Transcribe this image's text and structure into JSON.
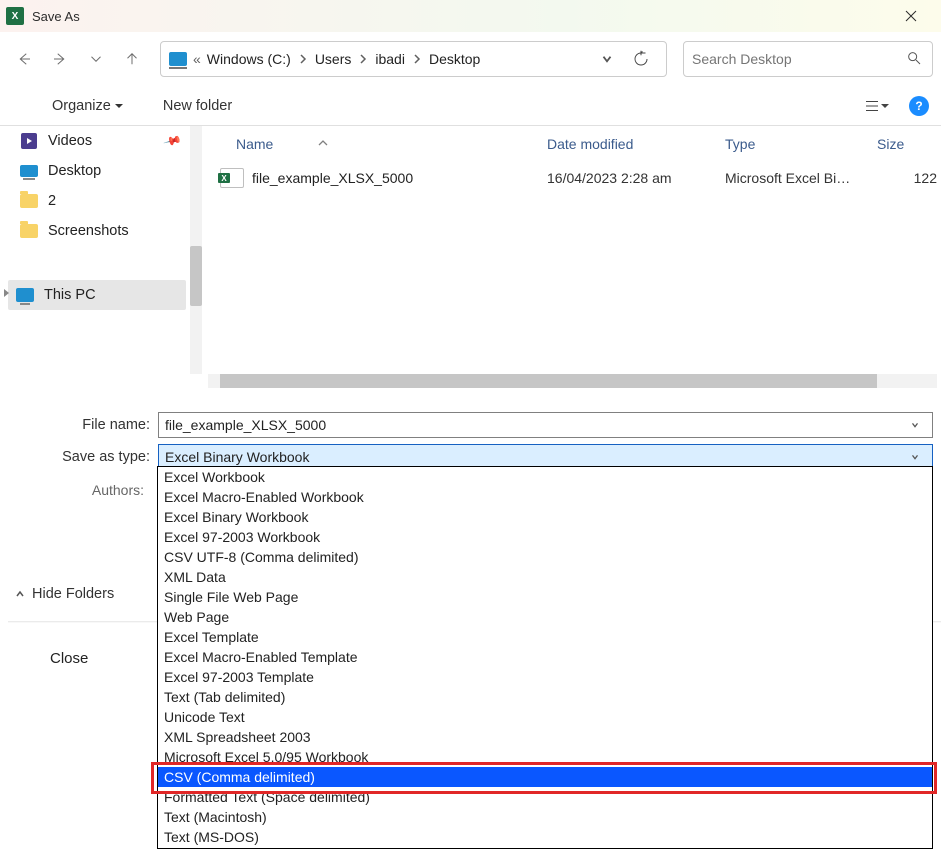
{
  "titlebar": {
    "title": "Save As"
  },
  "breadcrumb": {
    "drive_prefix": "«",
    "parts": [
      "Windows (C:)",
      "Users",
      "ibadi",
      "Desktop"
    ]
  },
  "search": {
    "placeholder": "Search Desktop"
  },
  "actionbar": {
    "organize": "Organize",
    "new_folder": "New folder"
  },
  "sidebar": {
    "items": [
      {
        "label": "Videos",
        "pinned": true
      },
      {
        "label": "Desktop",
        "pinned": false
      },
      {
        "label": "2",
        "pinned": false
      },
      {
        "label": "Screenshots",
        "pinned": false
      }
    ],
    "this_pc": "This PC"
  },
  "columns": {
    "name": "Name",
    "date": "Date modified",
    "type": "Type",
    "size": "Size"
  },
  "files": [
    {
      "name": "file_example_XLSX_5000",
      "date": "16/04/2023 2:28 am",
      "type": "Microsoft Excel Bi…",
      "size": "122"
    }
  ],
  "fields": {
    "file_name_label": "File name:",
    "file_name_value": "file_example_XLSX_5000",
    "save_as_type_label": "Save as type:",
    "save_as_type_value": "Excel Binary Workbook",
    "authors_label": "Authors:"
  },
  "dropdown_options": [
    "Excel Workbook",
    "Excel Macro-Enabled Workbook",
    "Excel Binary Workbook",
    "Excel 97-2003 Workbook",
    "CSV UTF-8 (Comma delimited)",
    "XML Data",
    "Single File Web Page",
    "Web Page",
    "Excel Template",
    "Excel Macro-Enabled Template",
    "Excel 97-2003 Template",
    "Text (Tab delimited)",
    "Unicode Text",
    "XML Spreadsheet 2003",
    "Microsoft Excel 5.0/95 Workbook",
    "CSV (Comma delimited)",
    "Formatted Text (Space delimited)",
    "Text (Macintosh)",
    "Text (MS-DOS)"
  ],
  "dropdown_selected_index": 15,
  "footer": {
    "hide_folders": "Hide Folders",
    "close": "Close"
  },
  "help_glyph": "?"
}
